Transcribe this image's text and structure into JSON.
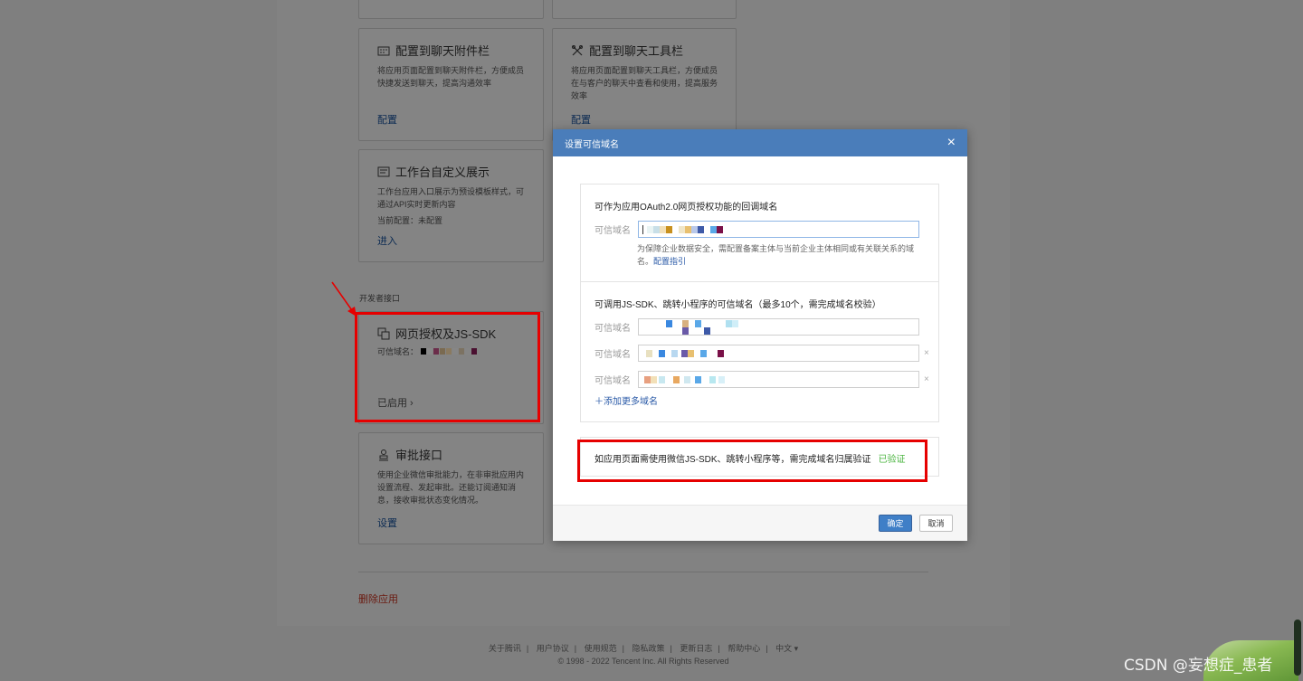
{
  "cards": {
    "attach": {
      "title": "配置到聊天附件栏",
      "desc": "将应用页面配置到聊天附件栏，方便成员快捷发送到聊天，提高沟通效率",
      "link": "配置"
    },
    "toolbar": {
      "title": "配置到聊天工具栏",
      "desc": "将应用页面配置到聊天工具栏，方便成员在与客户的聊天中查看和使用，提高服务效率",
      "link": "配置"
    },
    "workbench": {
      "title": "工作台自定义展示",
      "desc": "工作台应用入口展示为预设模板样式，可通过API实时更新内容",
      "meta": "当前配置：未配置",
      "link": "进入"
    },
    "jssdk": {
      "title": "网页授权及JS-SDK",
      "meta": "可信域名：",
      "link": "已启用 ›"
    },
    "approval": {
      "title": "审批接口",
      "desc": "使用企业微信审批能力，在非审批应用内设置流程、发起审批。还能订阅通知消息，接收审批状态变化情况。",
      "link": "设置"
    }
  },
  "section_label": "开发者接口",
  "delete_label": "删除应用",
  "footer": {
    "links": [
      "关于腾讯",
      "用户协议",
      "使用规范",
      "隐私政策",
      "更新日志",
      "帮助中心",
      "中文 ▾"
    ],
    "copyright": "© 1998 - 2022 Tencent Inc. All Rights Reserved"
  },
  "modal": {
    "title": "设置可信域名",
    "close": "×",
    "oauth": {
      "title": "可作为应用OAuth2.0网页授权功能的回调域名",
      "label": "可信域名",
      "hint": "为保障企业数据安全，需配置备案主体与当前企业主体相同或有关联关系的域名。",
      "hint_link": "配置指引"
    },
    "jssdk": {
      "title": "可调用JS-SDK、跳转小程序的可信域名（最多10个，需完成域名校验）",
      "label": "可信域名",
      "remove": "×",
      "add_more": "＋添加更多域名"
    },
    "verify": {
      "text": "如应用页面需使用微信JS-SDK、跳转小程序等，需完成域名归属验证",
      "status": "已验证"
    },
    "ok": "确定",
    "cancel": "取消"
  },
  "watermark": "CSDN @妄想症_患者",
  "colors": {
    "accent": "#4a7dba",
    "verified": "#4bb540",
    "annotation": "#e60000"
  }
}
